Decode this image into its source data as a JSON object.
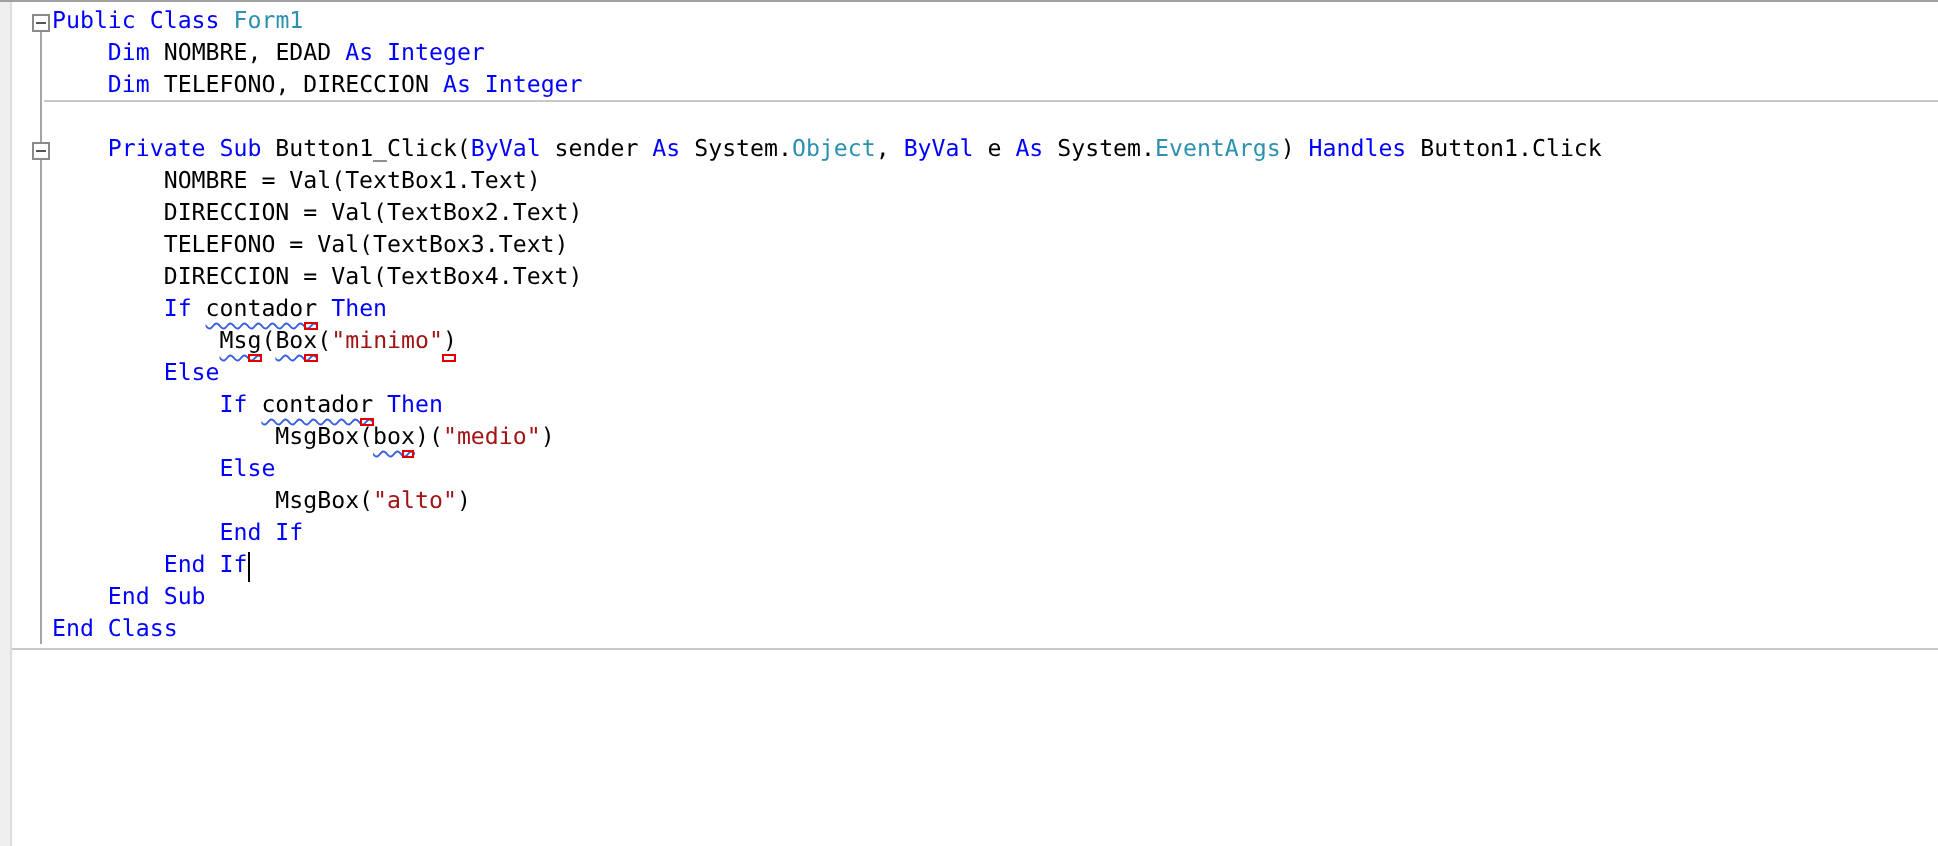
{
  "editor": {
    "lines": [
      {
        "fold": true,
        "tokens": [
          {
            "kind": "keyword",
            "text": "Public Class "
          },
          {
            "kind": "type",
            "text": "Form1"
          }
        ]
      },
      {
        "tokens": [
          {
            "kind": "keyword",
            "text": "    Dim"
          },
          {
            "kind": "plain",
            "text": " NOMBRE, EDAD "
          },
          {
            "kind": "keyword",
            "text": "As Integer"
          }
        ]
      },
      {
        "separator": true,
        "tokens": [
          {
            "kind": "keyword",
            "text": "    Dim"
          },
          {
            "kind": "plain",
            "text": " TELEFONO, DIRECCION "
          },
          {
            "kind": "keyword",
            "text": "As Integer"
          }
        ]
      },
      {
        "kind": "blank"
      },
      {
        "fold": true,
        "tokens": [
          {
            "kind": "keyword",
            "text": "    Private Sub"
          },
          {
            "kind": "plain",
            "text": " Button1_Click("
          },
          {
            "kind": "keyword",
            "text": "ByVal"
          },
          {
            "kind": "plain",
            "text": " sender "
          },
          {
            "kind": "keyword",
            "text": "As"
          },
          {
            "kind": "plain",
            "text": " System."
          },
          {
            "kind": "type",
            "text": "Object"
          },
          {
            "kind": "plain",
            "text": ", "
          },
          {
            "kind": "keyword",
            "text": "ByVal"
          },
          {
            "kind": "plain",
            "text": " e "
          },
          {
            "kind": "keyword",
            "text": "As"
          },
          {
            "kind": "plain",
            "text": " System."
          },
          {
            "kind": "type",
            "text": "EventArgs"
          },
          {
            "kind": "plain",
            "text": ") "
          },
          {
            "kind": "keyword",
            "text": "Handles"
          },
          {
            "kind": "plain",
            "text": " Button1.Click"
          }
        ]
      },
      {
        "tokens": [
          {
            "kind": "plain",
            "text": "        NOMBRE = Val(TextBox1.Text)"
          }
        ]
      },
      {
        "tokens": [
          {
            "kind": "plain",
            "text": "        DIRECCION = Val(TextBox2.Text)"
          }
        ]
      },
      {
        "tokens": [
          {
            "kind": "plain",
            "text": "        TELEFONO = Val(TextBox3.Text)"
          }
        ]
      },
      {
        "tokens": [
          {
            "kind": "plain",
            "text": "        DIRECCION = Val(TextBox4.Text)"
          }
        ]
      },
      {
        "tokens": [
          {
            "kind": "keyword",
            "text": "        If "
          },
          {
            "kind": "plain",
            "text": "contador",
            "squiggle": true,
            "marker": true
          },
          {
            "kind": "keyword",
            "text": " Then"
          }
        ]
      },
      {
        "tokens": [
          {
            "kind": "plain",
            "text": "            Msg",
            "squiggle": true,
            "marker": true
          },
          {
            "kind": "plain",
            "text": "("
          },
          {
            "kind": "plain",
            "text": "Box",
            "squiggle": true,
            "marker": true
          },
          {
            "kind": "plain",
            "text": "("
          },
          {
            "kind": "string",
            "text": "\"minimo\""
          },
          {
            "kind": "plain",
            "text": ")",
            "marker": true
          }
        ]
      },
      {
        "tokens": [
          {
            "kind": "keyword",
            "text": "        Else"
          }
        ]
      },
      {
        "tokens": [
          {
            "kind": "keyword",
            "text": "            If "
          },
          {
            "kind": "plain",
            "text": "contador",
            "squiggle": true,
            "marker": true
          },
          {
            "kind": "keyword",
            "text": " Then"
          }
        ]
      },
      {
        "tokens": [
          {
            "kind": "plain",
            "text": "                MsgBox("
          },
          {
            "kind": "plain",
            "text": "box",
            "squiggle": true,
            "marker": true
          },
          {
            "kind": "plain",
            "text": ")("
          },
          {
            "kind": "string",
            "text": "\"medio\""
          },
          {
            "kind": "plain",
            "text": ")"
          }
        ]
      },
      {
        "tokens": [
          {
            "kind": "keyword",
            "text": "            Else"
          }
        ]
      },
      {
        "tokens": [
          {
            "kind": "plain",
            "text": "                MsgBox("
          },
          {
            "kind": "string",
            "text": "\"alto\""
          },
          {
            "kind": "plain",
            "text": ")"
          }
        ]
      },
      {
        "tokens": [
          {
            "kind": "keyword",
            "text": "            End If"
          }
        ]
      },
      {
        "cursor": true,
        "tokens": [
          {
            "kind": "keyword",
            "text": "        End If"
          }
        ]
      },
      {
        "tokens": [
          {
            "kind": "keyword",
            "text": "    End Sub"
          }
        ]
      },
      {
        "tokens": [
          {
            "kind": "keyword",
            "text": "End Class"
          }
        ]
      }
    ]
  }
}
